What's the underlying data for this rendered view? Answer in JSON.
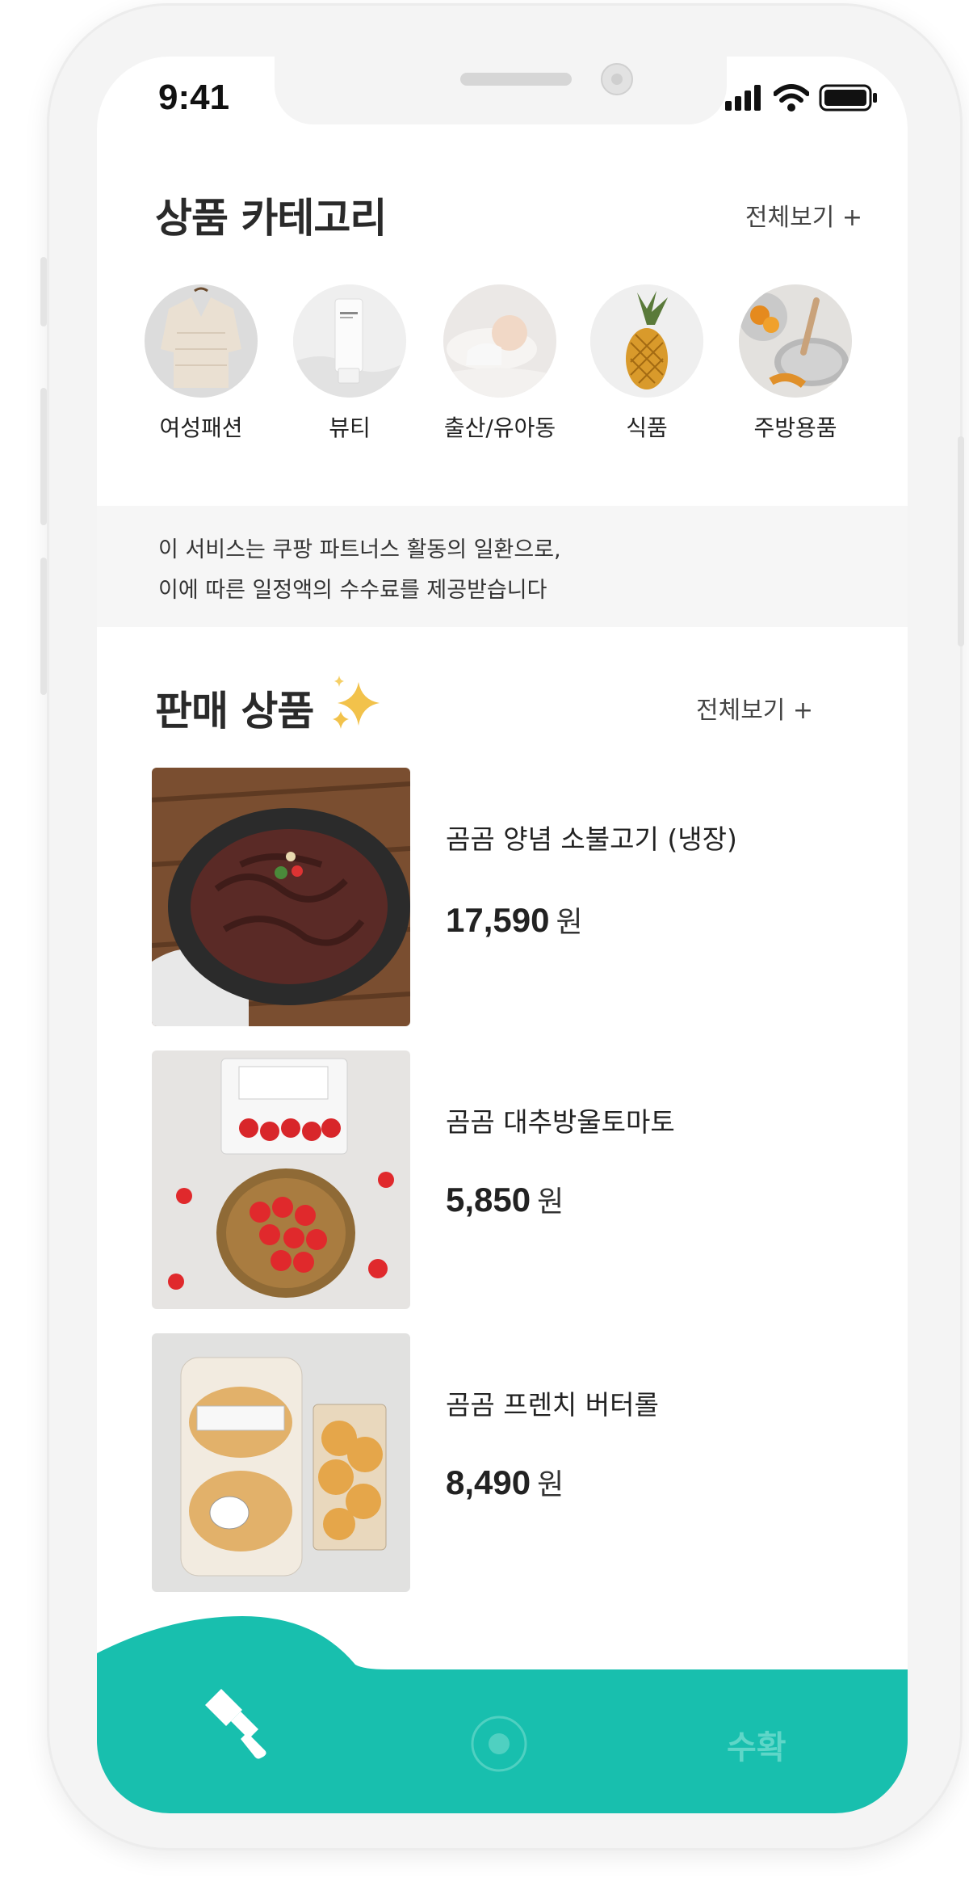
{
  "status_bar": {
    "time": "9:41"
  },
  "categories_section": {
    "title": "상품 카테고리",
    "view_all": "전체보기 +",
    "items": [
      {
        "label": "여성패션",
        "icon": "sweater-photo"
      },
      {
        "label": "뷰티",
        "icon": "cosmetic-tube-photo"
      },
      {
        "label": "출산/유아동",
        "icon": "sleeping-baby-photo"
      },
      {
        "label": "식품",
        "icon": "pineapple-photo"
      },
      {
        "label": "주방용품",
        "icon": "kitchen-pan-photo"
      }
    ]
  },
  "notice": {
    "line1": "이 서비스는 쿠팡 파트너스 활동의 일환으로,",
    "line2": "이에 따른 일정액의 수수료를 제공받습니다"
  },
  "products_section": {
    "title": "판매 상품",
    "title_icon": "sparkles-icon",
    "view_all": "전체보기 +",
    "items": [
      {
        "name": "곰곰 양념 소불고기 (냉장)",
        "price": "17,590",
        "currency": "원",
        "image": "bulgogi-photo"
      },
      {
        "name": "곰곰 대추방울토마토",
        "price": "5,850",
        "currency": "원",
        "image": "cherry-tomato-photo"
      },
      {
        "name": "곰곰 프렌치 버터롤",
        "price": "8,490",
        "currency": "원",
        "image": "butter-roll-photo"
      }
    ]
  },
  "tab_bar": {
    "color": "#18bfae",
    "tabs": [
      {
        "icon": "trowel-icon"
      },
      {
        "icon": "circle-dot-icon"
      },
      {
        "label": "수확"
      }
    ]
  }
}
